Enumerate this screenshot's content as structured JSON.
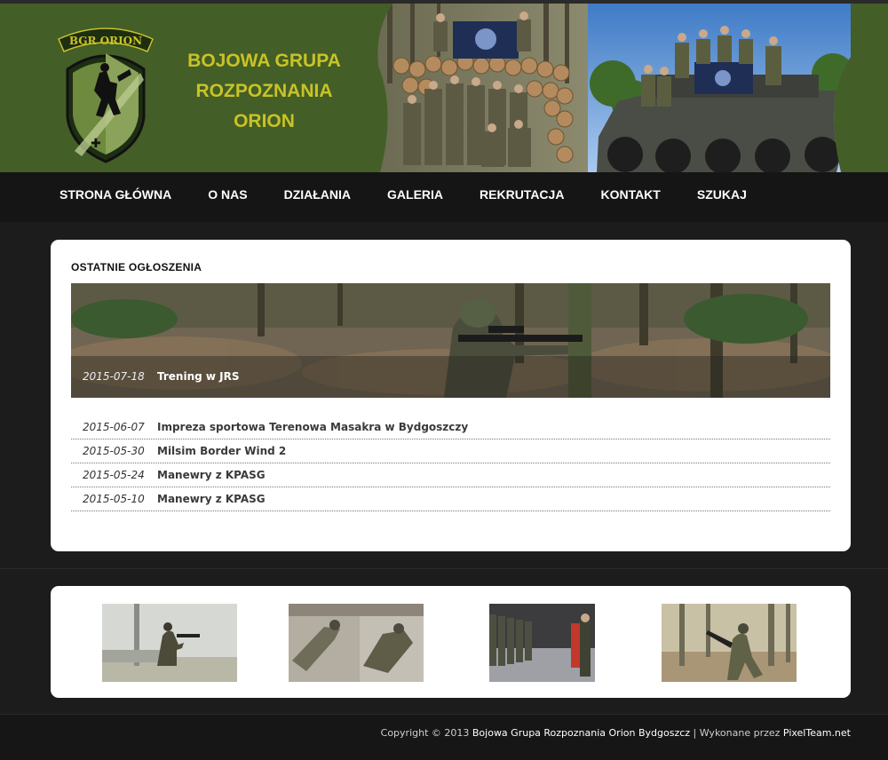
{
  "site": {
    "logo_text": "BGR ORION",
    "title_lines": [
      "BOJOWA GRUPA",
      "ROZPOZNANIA",
      "ORION"
    ]
  },
  "nav": {
    "items": [
      "STRONA GŁÓWNA",
      "O NAS",
      "DZIAŁANIA",
      "GALERIA",
      "REKRUTACJA",
      "KONTAKT",
      "SZUKAJ"
    ]
  },
  "news": {
    "heading": "OSTATNIE OGŁOSZENIA",
    "featured": {
      "date": "2015-07-18",
      "title": "Trening w JRS"
    },
    "items": [
      {
        "date": "2015-06-07",
        "title": "Impreza sportowa Terenowa Masakra w Bydgoszczy"
      },
      {
        "date": "2015-05-30",
        "title": "Milsim Border Wind 2"
      },
      {
        "date": "2015-05-24",
        "title": "Manewry z KPASG"
      },
      {
        "date": "2015-05-10",
        "title": "Manewry z KPASG"
      }
    ]
  },
  "footer": {
    "prefix": "Copyright © 2013 ",
    "org": "Bojowa Grupa Rozpoznania Orion Bydgoszcz",
    "middle": " | Wykonane przez ",
    "author": "PixelTeam.net"
  },
  "colors": {
    "header_green": "#435e27",
    "title_yellow": "#c9c326",
    "nav_bg": "#151515"
  }
}
